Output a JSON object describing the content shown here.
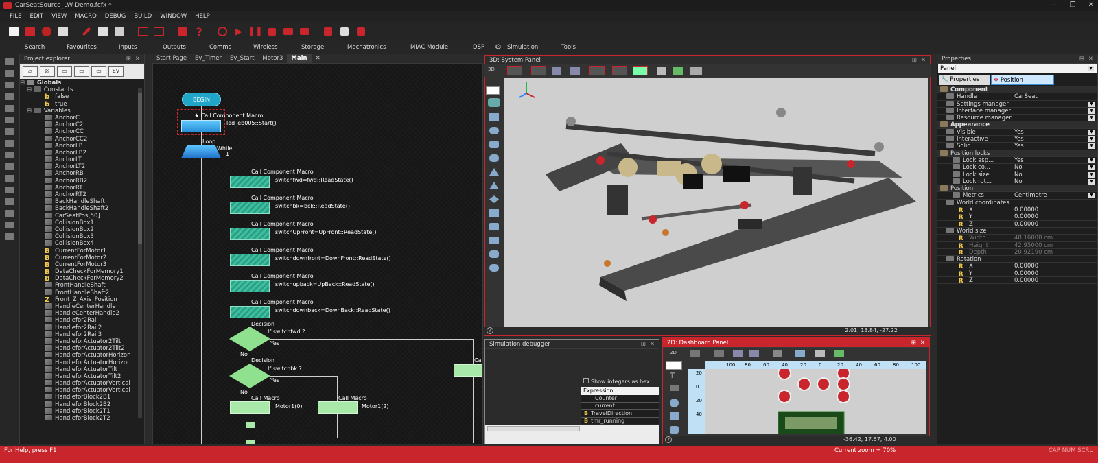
{
  "window": {
    "title": "CarSeatSource_LW-Demo.fcfx *",
    "controls": [
      "—",
      "❐",
      "✕"
    ]
  },
  "menu": [
    "FILE",
    "EDIT",
    "VIEW",
    "MACRO",
    "DEBUG",
    "BUILD",
    "WINDOW",
    "HELP"
  ],
  "components": [
    "Search",
    "Favourites",
    "Inputs",
    "Outputs",
    "Comms",
    "Wireless",
    "Storage",
    "Mechatronics",
    "MIAC Module",
    "DSP",
    "Simulation",
    "Tools"
  ],
  "project_explorer": {
    "title": "Project explorer",
    "globals": "Globals",
    "constants": "Constants",
    "const_items": [
      "false",
      "true"
    ],
    "variables": "Variables",
    "var_items": [
      [
        "v",
        "AnchorC"
      ],
      [
        "v",
        "AnchorC2"
      ],
      [
        "v",
        "AnchorCC"
      ],
      [
        "v",
        "AnchorCC2"
      ],
      [
        "v",
        "AnchorLB"
      ],
      [
        "v",
        "AnchorLB2"
      ],
      [
        "v",
        "AnchorLT"
      ],
      [
        "v",
        "AnchorLT2"
      ],
      [
        "v",
        "AnchorRB"
      ],
      [
        "v",
        "AnchorRB2"
      ],
      [
        "v",
        "AnchorRT"
      ],
      [
        "v",
        "AnchorRT2"
      ],
      [
        "v",
        "BackHandleShaft"
      ],
      [
        "v",
        "BackHandleShaft2"
      ],
      [
        "v",
        "CarSeatPos[50]"
      ],
      [
        "v",
        "CollisionBox1"
      ],
      [
        "v",
        "CollisionBox2"
      ],
      [
        "v",
        "CollisionBox3"
      ],
      [
        "v",
        "CollisionBox4"
      ],
      [
        "B",
        "CurrentForMotor1"
      ],
      [
        "B",
        "CurrentForMotor2"
      ],
      [
        "B",
        "CurrentForMotor3"
      ],
      [
        "B",
        "DataCheckForMemory1"
      ],
      [
        "B",
        "DataCheckForMemory2"
      ],
      [
        "v",
        "FrontHandleShaft"
      ],
      [
        "v",
        "FrontHandleShaft2"
      ],
      [
        "Z",
        "Front_Z_Axis_Position"
      ],
      [
        "v",
        "HandleCenterHandle"
      ],
      [
        "v",
        "HandleCenterHandle2"
      ],
      [
        "v",
        "Handlefor2Rail"
      ],
      [
        "v",
        "Handlefor2Rail2"
      ],
      [
        "v",
        "Handlefor2Rail3"
      ],
      [
        "v",
        "HandleforActuator2Tilt"
      ],
      [
        "v",
        "HandleforActuator2Tilt2"
      ],
      [
        "v",
        "HandleforActuatorHorizon"
      ],
      [
        "v",
        "HandleforActuatorHorizon"
      ],
      [
        "v",
        "HandleforActuatorTilt"
      ],
      [
        "v",
        "HandleforActuatorTilt2"
      ],
      [
        "v",
        "HandleforActuatorVertical"
      ],
      [
        "v",
        "HandleforActuatorVertical"
      ],
      [
        "v",
        "HandleforBlock2B1"
      ],
      [
        "v",
        "HandleforBlock2B2"
      ],
      [
        "v",
        "HandleforBlock2T1"
      ],
      [
        "v",
        "HandleforBlock2T2"
      ]
    ]
  },
  "tabs": [
    "Start Page",
    "Ev_Timer",
    "Ev_Start",
    "Motor3",
    "Main"
  ],
  "flow": {
    "begin": "BEGIN",
    "call_comp": "Call Component Macro",
    "first_call": "led_eb005::Start()",
    "loop": "Loop",
    "while": "While",
    "one": "1",
    "calls": [
      "switchfwd=fwd::ReadState()",
      "switchbk=bck::ReadState()",
      "switchUpFront=UpFront::ReadState()",
      "switchdownfront=DownFront::ReadState()",
      "switchupback=UpBack::ReadState()",
      "switchdownback=DownBack::ReadState()"
    ],
    "decision": "Decision",
    "if1": "If  switchfwd ?",
    "if2": "If  switchbk ?",
    "yes": "Yes",
    "no": "No",
    "call_macro": "Call Macro",
    "m0": "Motor1(0)",
    "m2": "Motor1(2)",
    "cal": "Cal"
  },
  "panel3d": {
    "title": "3D: System Panel",
    "coords": "2.01, 13.84, -27.22",
    "mode": "3D"
  },
  "debugger": {
    "title": "Simulation debugger",
    "hex": "Show integers as hex",
    "expression": "Expression",
    "items": [
      "Counter",
      "current",
      "TravelDirection",
      "tmr_running"
    ]
  },
  "dashboard": {
    "title": "2D: Dashboard Panel",
    "coords": "-36.42, 17.57, 4.00",
    "mode": "2D",
    "ruler_x": [
      "100",
      "80",
      "60",
      "40",
      "20",
      "0",
      "20",
      "40",
      "60",
      "80",
      "100"
    ],
    "ruler_y": [
      "20",
      "0",
      "20",
      "40"
    ]
  },
  "properties": {
    "title": "Properties",
    "selector": "Panel",
    "tab1": "Properties",
    "tab2": "Position",
    "rows": [
      {
        "k": "Component",
        "v": "",
        "lvl": 0,
        "sec": true
      },
      {
        "k": "Handle",
        "v": "CarSeat",
        "lvl": 1
      },
      {
        "k": "Settings manager",
        "v": "",
        "lvl": 1,
        "dd": true
      },
      {
        "k": "Interface manager",
        "v": "",
        "lvl": 1,
        "dd": true
      },
      {
        "k": "Resource manager",
        "v": "",
        "lvl": 1,
        "dd": true
      },
      {
        "k": "Appearance",
        "v": "",
        "lvl": 0,
        "sec": true
      },
      {
        "k": "Visible",
        "v": "Yes",
        "lvl": 1,
        "dd": true
      },
      {
        "k": "Interactive",
        "v": "Yes",
        "lvl": 1,
        "dd": true
      },
      {
        "k": "Solid",
        "v": "Yes",
        "lvl": 1,
        "dd": true
      },
      {
        "k": "Position locks",
        "v": "",
        "lvl": 0
      },
      {
        "k": "Lock asp...",
        "v": "Yes",
        "lvl": 2,
        "dd": true
      },
      {
        "k": "Lock co...",
        "v": "No",
        "lvl": 2,
        "dd": true
      },
      {
        "k": "Lock size",
        "v": "No",
        "lvl": 2,
        "dd": true
      },
      {
        "k": "Lock rot...",
        "v": "No",
        "lvl": 2,
        "dd": true
      },
      {
        "k": "Position",
        "v": "",
        "lvl": 0
      },
      {
        "k": "Metrics",
        "v": "Centimetre",
        "lvl": 2,
        "dd": true
      },
      {
        "k": "World coordinates",
        "v": "",
        "lvl": 1
      },
      {
        "k": "X",
        "v": "0.00000",
        "lvl": 3
      },
      {
        "k": "Y",
        "v": "0.00000",
        "lvl": 3
      },
      {
        "k": "Z",
        "v": "0.00000",
        "lvl": 3
      },
      {
        "k": "World size",
        "v": "",
        "lvl": 1
      },
      {
        "k": "Width",
        "v": "48.16000 cm",
        "lvl": 3,
        "dim": true
      },
      {
        "k": "Height",
        "v": "42.95000 cm",
        "lvl": 3,
        "dim": true
      },
      {
        "k": "Depth",
        "v": "20.92190 cm",
        "lvl": 3,
        "dim": true
      },
      {
        "k": "Rotation",
        "v": "",
        "lvl": 1
      },
      {
        "k": "X",
        "v": "0.00000",
        "lvl": 3
      },
      {
        "k": "Y",
        "v": "0.00000",
        "lvl": 3
      },
      {
        "k": "Z",
        "v": "0.00000",
        "lvl": 3
      }
    ]
  },
  "status": {
    "help": "For Help, press F1",
    "zoom": "Current zoom = 70%",
    "indicators": "CAP  NUM  SCRL"
  }
}
